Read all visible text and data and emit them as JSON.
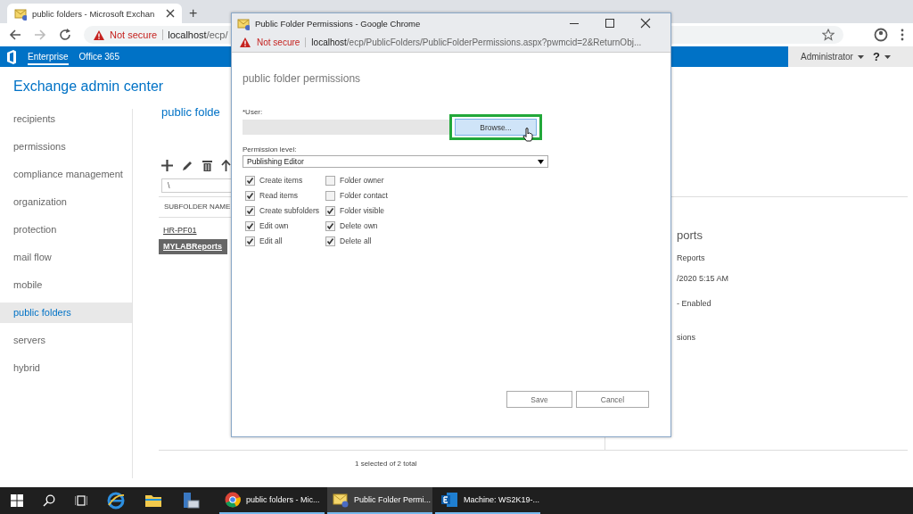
{
  "browser": {
    "tabs": [
      {
        "title": "public folders - Microsoft Exchan",
        "selected": true
      }
    ],
    "new_tab": "+",
    "security": "Not secure",
    "url_host": "localhost",
    "url_path": "/ecp/"
  },
  "suite_bar": {
    "items": [
      {
        "label": "Enterprise",
        "selected": true
      },
      {
        "label": "Office 365",
        "selected": false
      }
    ],
    "user": "Administrator",
    "help": "?"
  },
  "app_title": "Exchange admin center",
  "sidebar": {
    "items": [
      {
        "label": "recipients",
        "selected": false
      },
      {
        "label": "permissions",
        "selected": false
      },
      {
        "label": "compliance management",
        "selected": false
      },
      {
        "label": "organization",
        "selected": false
      },
      {
        "label": "protection",
        "selected": false
      },
      {
        "label": "mail flow",
        "selected": false
      },
      {
        "label": "mobile",
        "selected": false
      },
      {
        "label": "public folders",
        "selected": true
      },
      {
        "label": "servers",
        "selected": false
      },
      {
        "label": "hybrid",
        "selected": false
      }
    ]
  },
  "main": {
    "heading": "public folde",
    "path_value": "\\",
    "table": {
      "columns": [
        "SUBFOLDER NAME"
      ],
      "rows": [
        {
          "name": "HR-PF01",
          "selected": false
        },
        {
          "name": "MYLABReports",
          "selected": true
        }
      ]
    },
    "details": [
      "ports",
      "Reports",
      "/2020 5:15 AM",
      "- Enabled",
      "sions"
    ],
    "status": "1 selected of 2 total"
  },
  "popup": {
    "title": "Public Folder Permissions - Google Chrome",
    "security": "Not secure",
    "url_host": "localhost",
    "url_path": "/ecp/PublicFolders/PublicFolderPermissions.aspx?pwmcid=2&ReturnObj...",
    "heading": "public folder permissions",
    "user_label": "*User:",
    "browse": "Browse...",
    "level_label": "Permission level:",
    "level_value": "Publishing Editor",
    "permissions": [
      {
        "label": "Create items",
        "checked": true
      },
      {
        "label": "Folder owner",
        "checked": false
      },
      {
        "label": "Read items",
        "checked": true
      },
      {
        "label": "Folder contact",
        "checked": false
      },
      {
        "label": "Create subfolders",
        "checked": true
      },
      {
        "label": "Folder visible",
        "checked": true
      },
      {
        "label": "Edit own",
        "checked": true
      },
      {
        "label": "Delete own",
        "checked": true
      },
      {
        "label": "Edit all",
        "checked": true
      },
      {
        "label": "Delete all",
        "checked": true
      }
    ],
    "buttons": [
      "Save",
      "Cancel"
    ]
  },
  "taskbar": {
    "windows": [
      {
        "kind": "chrome",
        "label": "public folders - Mic...",
        "selected": false
      },
      {
        "kind": "mail",
        "label": "Public Folder Permi...",
        "selected": true
      },
      {
        "kind": "exchange",
        "label": "Machine: WS2K19-...",
        "selected": false
      }
    ]
  }
}
